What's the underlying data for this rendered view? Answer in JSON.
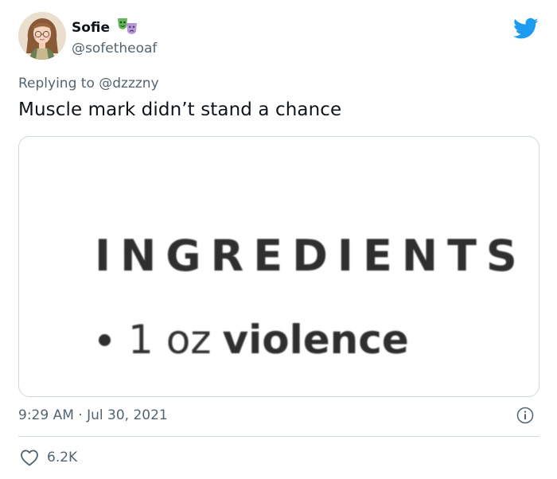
{
  "author": {
    "display_name": "Sofie",
    "handle": "@sofetheoaf",
    "badge_icons": [
      "theater-mask-green-icon",
      "theater-mask-purple-icon"
    ]
  },
  "reply": {
    "prefix": "Replying to ",
    "mention": "@dzzzny"
  },
  "tweet": {
    "text": "Muscle mark didn’t stand a chance"
  },
  "media": {
    "heading": "INGREDIENTS",
    "bullet_quantity": "1 oz",
    "bullet_item": "violence"
  },
  "meta": {
    "timestamp": "9:29 AM · Jul 30, 2021",
    "like_count": "6.2K"
  },
  "colors": {
    "twitter_blue": "#1d9bf0",
    "muted": "#536471",
    "text": "#0f1419",
    "border": "#cfd9de"
  },
  "icons": {
    "brand": "twitter-bird-icon",
    "info": "info-icon",
    "like": "heart-icon"
  }
}
